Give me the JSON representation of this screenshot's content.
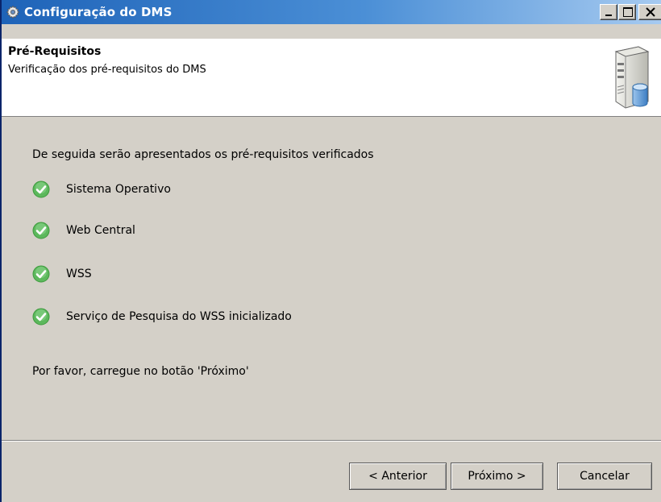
{
  "window": {
    "title": "Configuração do DMS",
    "title_icon": "gear-icon",
    "controls": [
      "minimize-icon",
      "maximize-icon",
      "close-icon"
    ]
  },
  "header": {
    "title": "Pré-Requisitos",
    "subtitle": "Verificação dos pré-requisitos do DMS",
    "icon": "server-database-icon"
  },
  "content": {
    "intro": "De seguida serão apresentados os pré-requisitos verificados",
    "requirements": [
      {
        "label": "Sistema Operativo",
        "status": "ok"
      },
      {
        "label": "Web Central",
        "status": "ok"
      },
      {
        "label": "WSS",
        "status": "ok"
      },
      {
        "label": "Serviço de Pesquisa do WSS inicializado",
        "status": "ok"
      }
    ],
    "instruction": "Por favor, carregue no botão 'Próximo'"
  },
  "buttons": {
    "previous": "< Anterior",
    "next": "Próximo >",
    "cancel": "Cancelar"
  },
  "colors": {
    "title_gradient_start": "#1e63b8",
    "title_gradient_end": "#a6caf0",
    "check_green": "#4caf50",
    "dialog_background": "#d4d0c8"
  }
}
